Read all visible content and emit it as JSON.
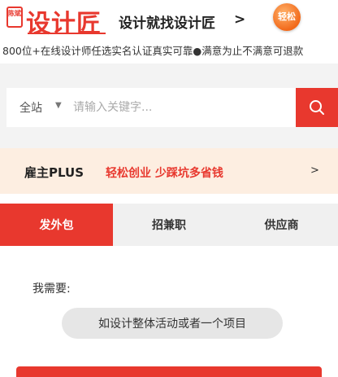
{
  "header": {
    "logo_seal": "陈斌",
    "logo_text": "设计匠",
    "slogan": "设计就找设计匠",
    "slogan_arrow": ">",
    "badge": "轻松"
  },
  "tagline": "800位+在线设计师任选实名认证真实可靠●满意为止不满意可退款",
  "search": {
    "scope": "全站",
    "placeholder": "请输入关键字...",
    "button_icon": "search-icon"
  },
  "promo": {
    "title": "雇主PLUS",
    "text": "轻松创业 少踩坑多省钱",
    "arrow": ">"
  },
  "tabs": [
    {
      "label": "发外包",
      "active": true
    },
    {
      "label": "招兼职",
      "active": false
    },
    {
      "label": "供应商",
      "active": false
    }
  ],
  "form": {
    "need_label": "我需要:",
    "project_option": "如设计整体活动或者一个项目"
  },
  "colors": {
    "brand_red": "#e8382e",
    "promo_bg": "#fdeee1",
    "search_band": "#f3f3f3"
  }
}
